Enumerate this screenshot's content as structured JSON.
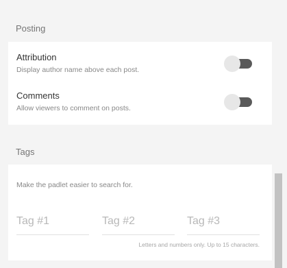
{
  "posting": {
    "header": "Posting",
    "attribution": {
      "title": "Attribution",
      "description": "Display author name above each post.",
      "enabled": false
    },
    "comments": {
      "title": "Comments",
      "description": "Allow viewers to comment on posts.",
      "enabled": false
    }
  },
  "tags": {
    "header": "Tags",
    "description": "Make the padlet easier to search for.",
    "fields": [
      {
        "placeholder": "Tag #1",
        "value": ""
      },
      {
        "placeholder": "Tag #2",
        "value": ""
      },
      {
        "placeholder": "Tag #3",
        "value": ""
      }
    ],
    "hint": "Letters and numbers only. Up to 15 characters."
  },
  "colors": {
    "toggle_track_off": "#5a5a5a",
    "toggle_knob_off": "#e7e7e7",
    "section_background": "#f4f4f4",
    "card_background": "#ffffff"
  },
  "icons": {
    "toggle": "toggle-switch-icon"
  }
}
